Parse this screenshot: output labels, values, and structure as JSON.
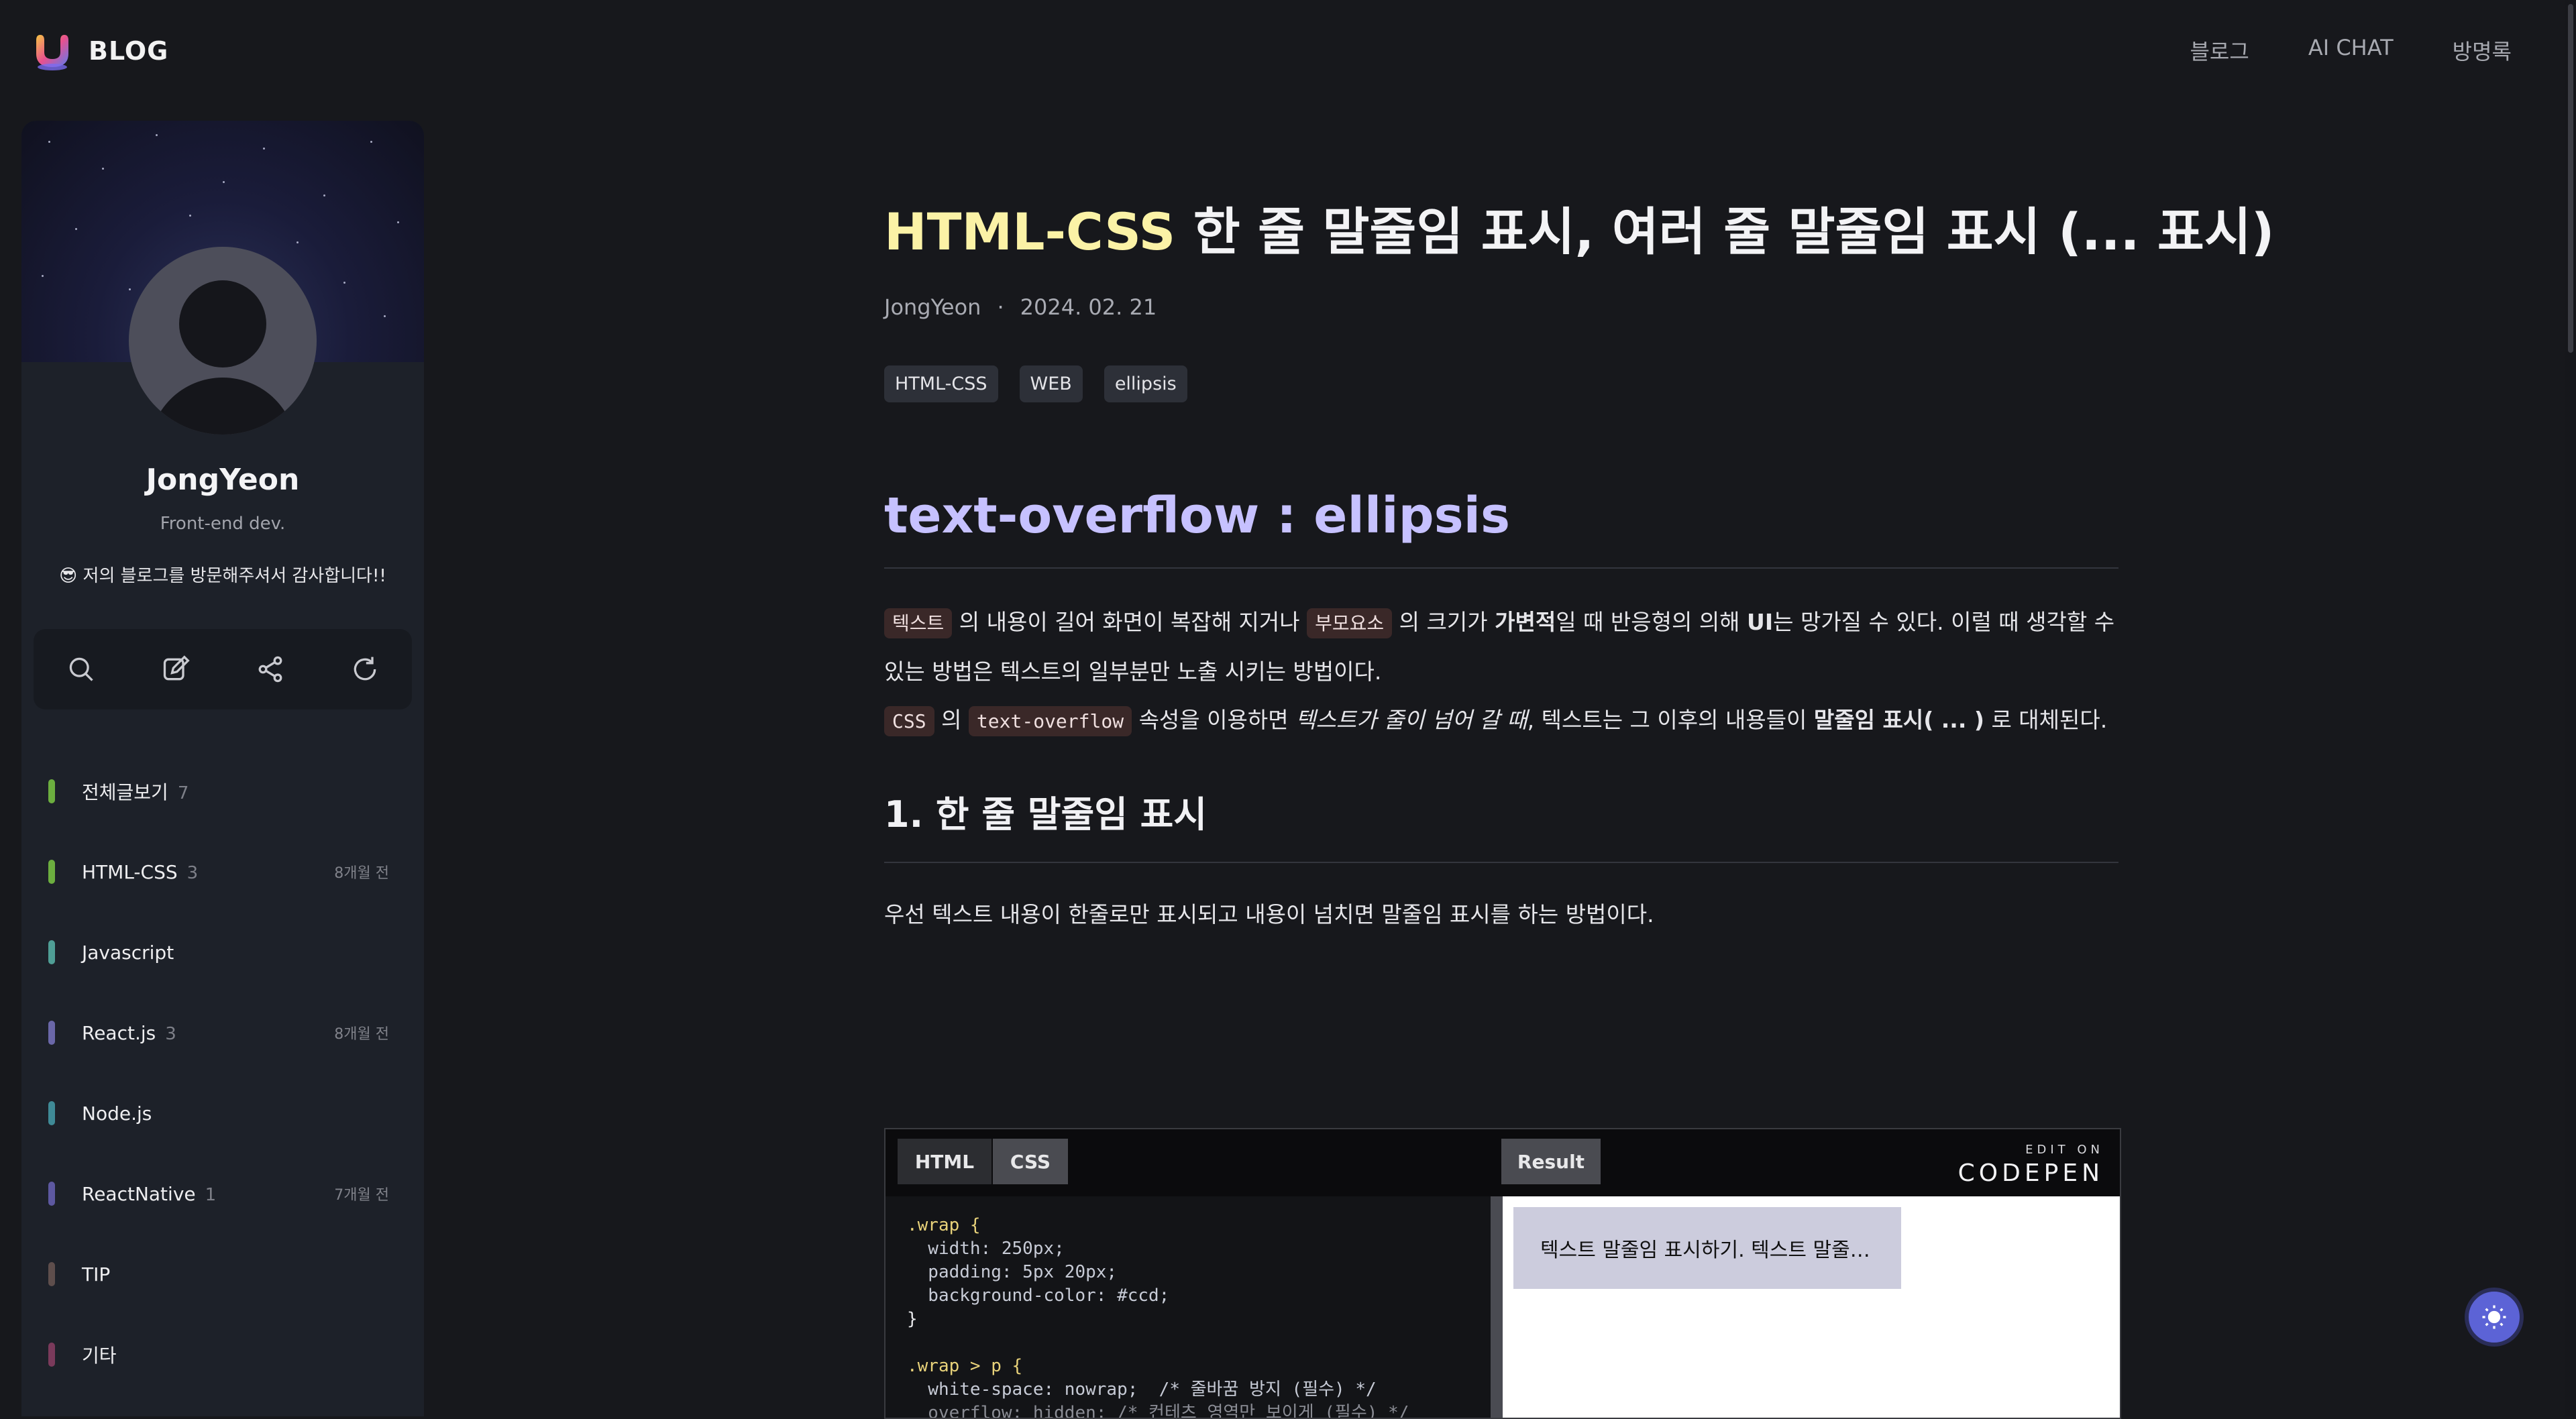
{
  "header": {
    "logo_text": "BLOG",
    "nav": [
      "블로그",
      "AI CHAT",
      "방명록"
    ]
  },
  "sidebar": {
    "name": "JongYeon",
    "role": "Front-end dev.",
    "message": "😎 저의 블로그를 방문해주셔서 감사합니다!!",
    "tools": [
      "search-icon",
      "edit-icon",
      "share-icon",
      "refresh-icon"
    ],
    "categories": [
      {
        "label": "전체글보기",
        "count": "7",
        "time": "",
        "color": "#6cae3f"
      },
      {
        "label": "HTML-CSS",
        "count": "3",
        "time": "8개월 전",
        "color": "#6cae3f"
      },
      {
        "label": "Javascript",
        "count": "",
        "time": "",
        "color": "#4f9e95"
      },
      {
        "label": "React.js",
        "count": "3",
        "time": "8개월 전",
        "color": "#6a67a8"
      },
      {
        "label": "Node.js",
        "count": "",
        "time": "",
        "color": "#3f8a96"
      },
      {
        "label": "ReactNative",
        "count": "1",
        "time": "7개월 전",
        "color": "#5d58a0"
      },
      {
        "label": "TIP",
        "count": "",
        "time": "",
        "color": "#5e4e4c"
      },
      {
        "label": "기타",
        "count": "",
        "time": "",
        "color": "#7a3a5b"
      }
    ]
  },
  "post": {
    "title_category": "HTML-CSS",
    "title_rest": " 한 줄 말줄임 표시, 여러 줄 말줄임 표시 (... 표시)",
    "author": "JongYeon",
    "separator": "·",
    "date": "2024. 02. 21",
    "tags": [
      "HTML-CSS",
      "WEB",
      "ellipsis"
    ],
    "h2": "text-overflow : ellipsis",
    "p1": {
      "code1": "텍스트",
      "t1": " 의 내용이 길어 화면이 복잡해 지거나 ",
      "code2": "부모요소",
      "t2": " 의 크기가 ",
      "b1": "가변적",
      "t3": "일 때 반응형의 의해 ",
      "b2": "UI",
      "t4": "는 망가질 수 있다. 이럴 때 생각할 수 있는 방법은 텍스트의 일부분만 노출 시키는 방법이다."
    },
    "p2": {
      "code1": "CSS",
      "t1": " 의 ",
      "code2": "text-overflow",
      "t2": " 속성을 이용하면 ",
      "i1": "텍스트가 줄이 넘어 갈 때",
      "t3": ", 텍스트는 그 이후의 내용들이 ",
      "b1": "말줄임 표시( ... )",
      "t4": " 로 대체된다."
    },
    "h3": "1. 한 줄 말줄임 표시",
    "p3": "우선 텍스트 내용이 한줄로만 표시되고 내용이 넘치면 말줄임 표시를 하는 방법이다."
  },
  "codepen": {
    "tabs": [
      "HTML",
      "CSS"
    ],
    "result_tab": "Result",
    "edit_on": "EDIT ON",
    "brand": "CODEPEN",
    "code_lines": [
      ".wrap {",
      "  width: 250px;",
      "  padding: 5px 20px;",
      "  background-color: #ccd;",
      "}",
      "",
      ".wrap > p {",
      "  white-space: nowrap;  /* 줄바꿈 방지 (필수) */",
      "  overflow: hidden; /* 컨테츠 영역만 보이게 (필수) */"
    ],
    "result_text": "텍스트 말줄임 표시하기. 텍스트 말줄임 표시하기."
  },
  "colors": {
    "accent": "#c6c1ff",
    "title_category": "#fbf2a6",
    "background": "#17181c",
    "theme_button": "#5c63d6"
  }
}
